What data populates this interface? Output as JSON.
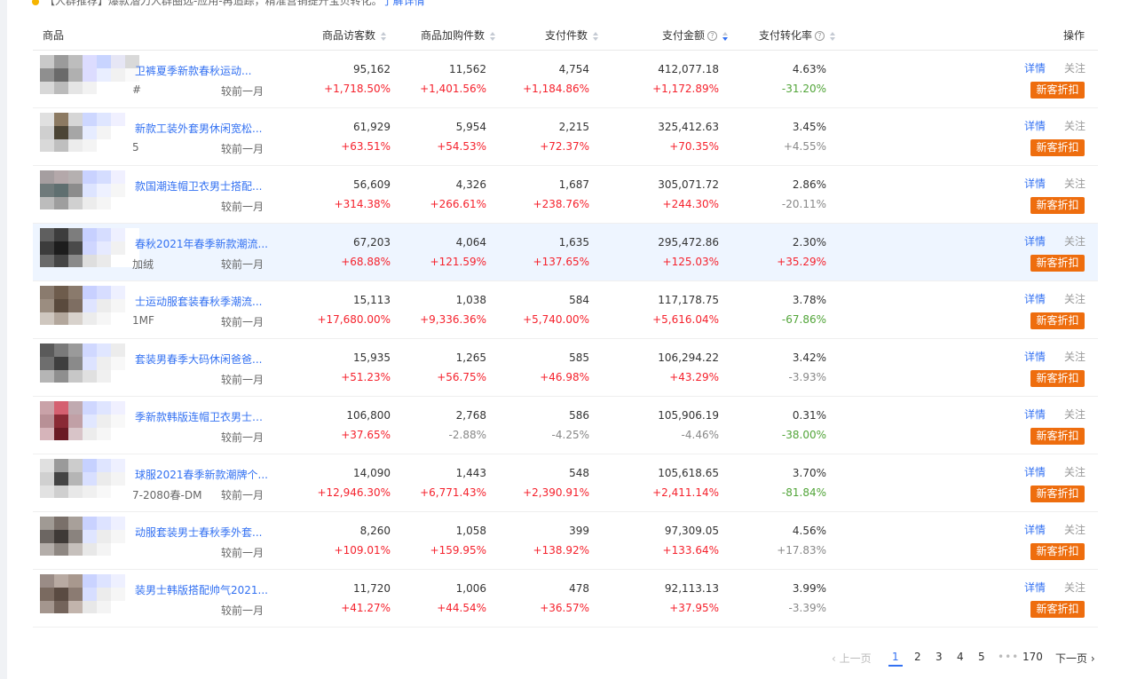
{
  "notice": {
    "text": "【人群推荐】爆款潜力人群圈选-应用-再追踪，精准营销提升宝贝转化。",
    "link": "了解详情"
  },
  "header": {
    "product": "商品",
    "visitors": "商品访客数",
    "cart_items": "商品加购件数",
    "paid_items": "支付件数",
    "paid_amount": "支付金额",
    "conversion": "支付转化率",
    "actions": "操作"
  },
  "compare_label": "较前一月",
  "actions": {
    "detail": "详情",
    "follow": "关注",
    "discount": "新客折扣"
  },
  "rows": [
    {
      "name": "卫裤夏季新款春秋运动...",
      "code": "#",
      "visitors": "95,162",
      "visitors_chg": "+1,718.50%",
      "cart": "11,562",
      "cart_chg": "+1,401.56%",
      "paid": "4,754",
      "paid_chg": "+1,184.86%",
      "amount": "412,077.18",
      "amount_chg": "+1,172.89%",
      "rate": "4.63%",
      "rate_chg": "-31.20%"
    },
    {
      "name": "新款工装外套男休闲宽松...",
      "code": "5",
      "visitors": "61,929",
      "visitors_chg": "+63.51%",
      "cart": "5,954",
      "cart_chg": "+54.53%",
      "paid": "2,215",
      "paid_chg": "+72.37%",
      "amount": "325,412.63",
      "amount_chg": "+70.35%",
      "rate": "3.45%",
      "rate_chg": "+4.55%"
    },
    {
      "name": "款国潮连帽卫衣男士搭配...",
      "code": "",
      "visitors": "56,609",
      "visitors_chg": "+314.38%",
      "cart": "4,326",
      "cart_chg": "+266.61%",
      "paid": "1,687",
      "paid_chg": "+238.76%",
      "amount": "305,071.72",
      "amount_chg": "+244.30%",
      "rate": "2.86%",
      "rate_chg": "-20.11%"
    },
    {
      "name": "春秋2021年春季新款潮流...",
      "code": "加绒",
      "visitors": "67,203",
      "visitors_chg": "+68.88%",
      "cart": "4,064",
      "cart_chg": "+121.59%",
      "paid": "1,635",
      "paid_chg": "+137.65%",
      "amount": "295,472.86",
      "amount_chg": "+125.03%",
      "rate": "2.30%",
      "rate_chg": "+35.29%"
    },
    {
      "name": "士运动服套装春秋季潮流...",
      "code": "1MF",
      "visitors": "15,113",
      "visitors_chg": "+17,680.00%",
      "cart": "1,038",
      "cart_chg": "+9,336.36%",
      "paid": "584",
      "paid_chg": "+5,740.00%",
      "amount": "117,178.75",
      "amount_chg": "+5,616.04%",
      "rate": "3.78%",
      "rate_chg": "-67.86%"
    },
    {
      "name": "套装男春季大码休闲爸爸...",
      "code": "",
      "visitors": "15,935",
      "visitors_chg": "+51.23%",
      "cart": "1,265",
      "cart_chg": "+56.75%",
      "paid": "585",
      "paid_chg": "+46.98%",
      "amount": "106,294.22",
      "amount_chg": "+43.29%",
      "rate": "3.42%",
      "rate_chg": "-3.93%"
    },
    {
      "name": "季新款韩版连帽卫衣男士运...",
      "code": "",
      "visitors": "106,800",
      "visitors_chg": "+37.65%",
      "cart": "2,768",
      "cart_chg": "-2.88%",
      "paid": "586",
      "paid_chg": "-4.25%",
      "amount": "105,906.19",
      "amount_chg": "-4.46%",
      "rate": "0.31%",
      "rate_chg": "-38.00%"
    },
    {
      "name": "球服2021春季新款潮牌个...",
      "code": "7-2080春-DM",
      "visitors": "14,090",
      "visitors_chg": "+12,946.30%",
      "cart": "1,443",
      "cart_chg": "+6,771.43%",
      "paid": "548",
      "paid_chg": "+2,390.91%",
      "amount": "105,618.65",
      "amount_chg": "+2,411.14%",
      "rate": "3.70%",
      "rate_chg": "-81.84%"
    },
    {
      "name": "动服套装男士春秋季外套...",
      "code": "",
      "visitors": "8,260",
      "visitors_chg": "+109.01%",
      "cart": "1,058",
      "cart_chg": "+159.95%",
      "paid": "399",
      "paid_chg": "+138.92%",
      "amount": "97,309.05",
      "amount_chg": "+133.64%",
      "rate": "4.56%",
      "rate_chg": "+17.83%"
    },
    {
      "name": "装男士韩版搭配帅气2021...",
      "code": "",
      "visitors": "11,720",
      "visitors_chg": "+41.27%",
      "cart": "1,006",
      "cart_chg": "+44.54%",
      "paid": "478",
      "paid_chg": "+36.57%",
      "amount": "92,113.13",
      "amount_chg": "+37.95%",
      "rate": "3.99%",
      "rate_chg": "-3.39%"
    }
  ],
  "pagination": {
    "prev": "上一页",
    "pages": [
      "1",
      "2",
      "3",
      "4",
      "5"
    ],
    "ellipsis": "•••",
    "last": "170",
    "next": "下一页",
    "current": "1"
  },
  "colors": {
    "accent": "#3371f2",
    "up": "#f5222d",
    "down_rate": "#52a539",
    "discount_btn": "#ee6d0e",
    "highlight_row": "#eef5ff"
  }
}
